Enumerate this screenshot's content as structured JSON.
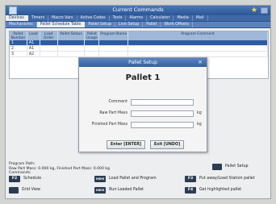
{
  "window": {
    "title": "Current Commands"
  },
  "tabs_row1": [
    "Devices",
    "Timers",
    "Macro Vars",
    "Active Codes",
    "Tools",
    "Alarms",
    "Calculator",
    "Media",
    "Mail"
  ],
  "tabs_row2": [
    "Mechanisms",
    "Pallet Schedule Table",
    "Pallet Setup",
    "Live Setup",
    "Pallet",
    "Work Offsets"
  ],
  "grid": {
    "headers": [
      "Pallet Number",
      "Load",
      "Load Order",
      "Pallet Status",
      "Pallet Usage",
      "Program Name",
      "Program Comment"
    ],
    "rows": [
      [
        "1",
        "A1",
        "",
        "",
        "",
        "",
        ""
      ],
      [
        "2",
        "A1",
        "",
        "",
        "",
        "",
        ""
      ],
      [
        "3",
        "A2",
        "",
        "",
        "",
        "",
        ""
      ]
    ]
  },
  "dialog": {
    "title": "Pallet Setup",
    "close": "×",
    "heading": "Pallet 1",
    "fields": [
      {
        "label": "Comment",
        "value": "",
        "unit": ""
      },
      {
        "label": "Raw Part Mass",
        "value": "",
        "unit": "kg"
      },
      {
        "label": "Finished Part Mass",
        "value": "",
        "unit": "kg"
      }
    ],
    "enter_label": "Enter [ENTER]",
    "exit_label": "Exit [UNDO]"
  },
  "status": {
    "line1": "Program Path:",
    "line2": "Raw Part Mass: 0.000 kg, Finished Part Mass: 0.000 kg",
    "line3": "Commands:"
  },
  "commands": [
    {
      "key": "F2",
      "label": "Schedule"
    },
    {
      "key": "MEM",
      "label": "Load Pallet and Program"
    },
    {
      "key": "F3",
      "label": "Put away/Load Station pallet"
    },
    {
      "key": "",
      "label": "Grid View"
    },
    {
      "key": "MEM",
      "label": "Run Loaded Pallet"
    },
    {
      "key": "F4",
      "label": "Get highlighted pallet"
    },
    {
      "key": "",
      "label": "Pallet Setup"
    }
  ],
  "colors": {
    "accent": "#33609f",
    "selected_row": "#2e5aa2",
    "key_bg": "#2c3c52"
  }
}
